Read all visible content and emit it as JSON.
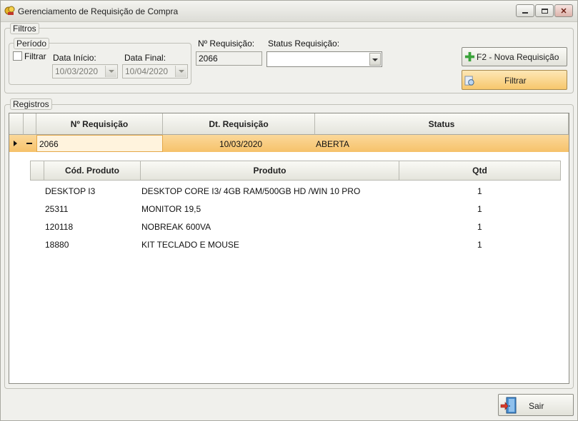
{
  "window": {
    "title": "Gerenciamento de Requisição de Compra",
    "minimize_icon": "minimize-icon",
    "maximize_icon": "maximize-icon",
    "close_icon": "close-icon"
  },
  "filters": {
    "group_label": "Filtros",
    "period": {
      "group_label": "Período",
      "filter_checkbox_label": "Filtrar",
      "filter_checked": false,
      "start_label": "Data Início:",
      "start_value": "10/03/2020",
      "end_label": "Data Final:",
      "end_value": "10/04/2020"
    },
    "req_number_label": "Nº Requisição:",
    "req_number_value": "2066",
    "status_label": "Status Requisição:",
    "status_value": "",
    "new_button": "F2 - Nova Requisição",
    "filter_button": "Filtrar"
  },
  "records": {
    "group_label": "Registros",
    "columns": [
      "Nº Requisição",
      "Dt. Requisição",
      "Status"
    ],
    "rows": [
      {
        "number": "2066",
        "date": "10/03/2020",
        "status": "ABERTA"
      }
    ],
    "detail": {
      "columns": [
        "Cód. Produto",
        "Produto",
        "Qtd"
      ],
      "rows": [
        {
          "code": "DESKTOP I3",
          "product": "DESKTOP CORE I3/ 4GB RAM/500GB HD /WIN 10 PRO",
          "qty": "1"
        },
        {
          "code": "25311",
          "product": "MONITOR 19,5",
          "qty": "1"
        },
        {
          "code": "120118",
          "product": "NOBREAK 600VA",
          "qty": "1"
        },
        {
          "code": "18880",
          "product": "KIT TECLADO E MOUSE",
          "qty": "1"
        }
      ]
    }
  },
  "footer": {
    "exit_button": "Sair"
  },
  "colors": {
    "selected_row": "#f6c26a",
    "orange_button": "#f7c76c",
    "window_bg": "#f0f0ec"
  }
}
